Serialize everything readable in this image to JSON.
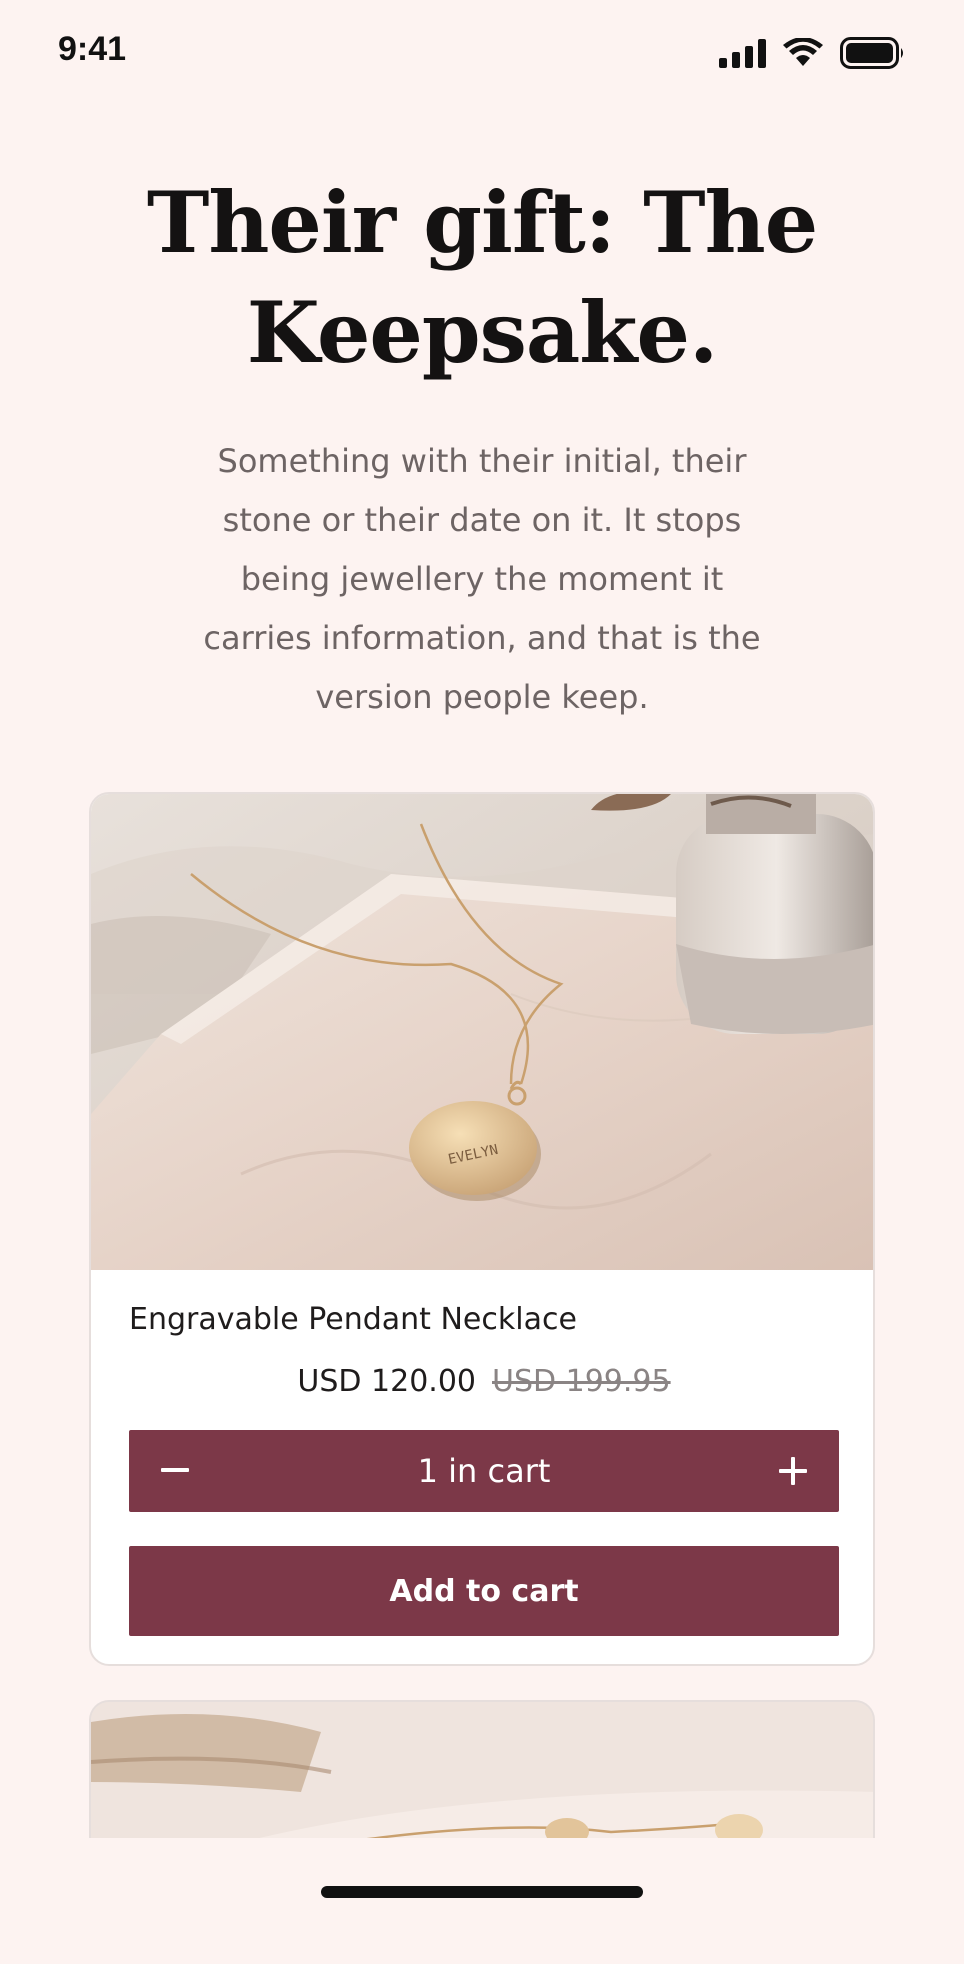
{
  "status_bar": {
    "time": "9:41",
    "icons": [
      "cellular-signal-icon",
      "wifi-icon",
      "battery-icon"
    ]
  },
  "header": {
    "title": "Their gift: The Keepsake.",
    "subtitle": "Something with their initial, their stone or their date on it. It stops being jewellery the moment it carries information, and that is the version people keep."
  },
  "products": [
    {
      "name": "Engravable Pendant Necklace",
      "price": "USD 120.00",
      "compare_price": "USD 199.95",
      "engraving": "EVELYN",
      "cart": {
        "decrement_icon": "minus-icon",
        "label": "1 in cart",
        "increment_icon": "plus-icon"
      },
      "add_to_cart_label": "Add to cart"
    }
  ],
  "colors": {
    "background": "#fdf3f1",
    "accent": "#7c3848",
    "card": "#ffffff"
  }
}
